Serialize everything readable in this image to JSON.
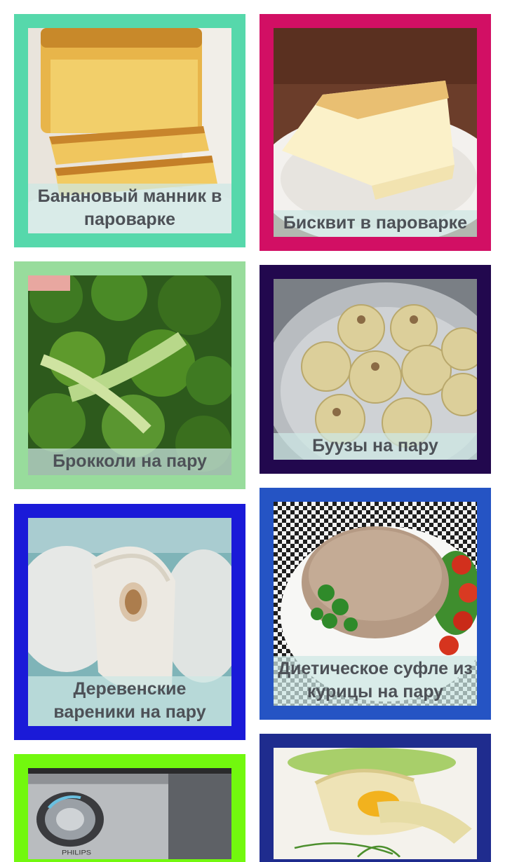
{
  "recipes": [
    {
      "title": "Банановый манник в пароварке",
      "border_color": "#56d8ab",
      "image": "banana-manna-cake"
    },
    {
      "title": "Бисквит в пароварке",
      "border_color": "#d20f64",
      "image": "sponge-cake"
    },
    {
      "title": "Брокколи на пару",
      "border_color": "#98dc9c",
      "image": "broccoli"
    },
    {
      "title": "Буузы на пару",
      "border_color": "#22084e",
      "image": "buuzy-dumplings"
    },
    {
      "title": "Деревенские вареники на пару",
      "border_color": "#1a1ad8",
      "image": "vareniki"
    },
    {
      "title": "Диетическое суфле из курицы на пару",
      "border_color": "#2554c4",
      "image": "chicken-souffle"
    },
    {
      "title": "",
      "border_color": "#72f80e",
      "image": "philips-steamer"
    },
    {
      "title": "",
      "border_color": "#1f2c8e",
      "image": "cabbage-rolls"
    }
  ]
}
